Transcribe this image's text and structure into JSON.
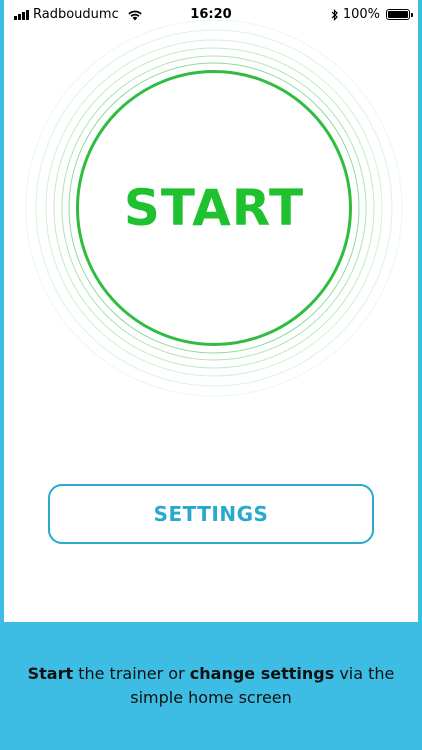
{
  "status_bar": {
    "carrier": "Radboudumc",
    "time": "16:20",
    "battery": "100%",
    "signal_icon": "signal-bars-icon",
    "wifi_icon": "wifi-icon",
    "bluetooth_icon": "bluetooth-icon",
    "battery_icon": "battery-icon",
    "battery_level": 1.0
  },
  "main": {
    "start_label": "START",
    "settings_label": "SETTINGS"
  },
  "caption": {
    "part1": "Start",
    "part2": " the trainer or ",
    "part3": "change settings",
    "part4": " via the simple home screen"
  },
  "colors": {
    "start_green": "#1fc12f",
    "ring_green": "#2ebd3f",
    "settings_blue": "#2aa9cf",
    "background_blue": "#3dbde3"
  }
}
